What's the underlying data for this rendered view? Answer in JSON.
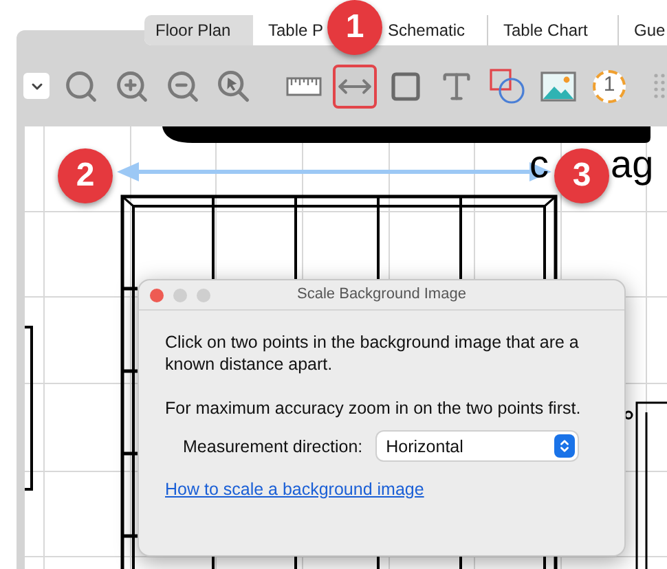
{
  "tabs": [
    {
      "label": "Floor Plan",
      "selected": true
    },
    {
      "label": "Table P",
      "selected": false
    },
    {
      "label": "Schematic",
      "selected": false
    },
    {
      "label": "Table Chart",
      "selected": false
    },
    {
      "label": "Gue",
      "selected": false
    }
  ],
  "toolbar": {
    "tools": [
      {
        "kind": "search",
        "selected": false
      },
      {
        "kind": "zoom-in",
        "selected": false
      },
      {
        "kind": "zoom-out",
        "selected": false
      },
      {
        "kind": "zoom-select",
        "selected": false
      },
      {
        "kind": "ruler",
        "selected": false
      },
      {
        "kind": "dimension",
        "selected": true
      },
      {
        "kind": "rectangle",
        "selected": false
      },
      {
        "kind": "text",
        "selected": false
      },
      {
        "kind": "shapes",
        "selected": false
      },
      {
        "kind": "image",
        "selected": false
      },
      {
        "kind": "number",
        "selected": false,
        "label": "1"
      },
      {
        "kind": "grid",
        "selected": false
      }
    ]
  },
  "canvas": {
    "text_fragments": [
      "c",
      "ag"
    ]
  },
  "callouts": [
    {
      "label": "1"
    },
    {
      "label": "2"
    },
    {
      "label": "3"
    }
  ],
  "dialog": {
    "title": "Scale Background Image",
    "paragraphs": [
      "Click on two points in the background image that are a known distance apart.",
      "For maximum accuracy zoom in on the two points first."
    ],
    "direction_label": "Measurement direction:",
    "direction_value": "Horizontal",
    "link": "How to scale a background image"
  }
}
